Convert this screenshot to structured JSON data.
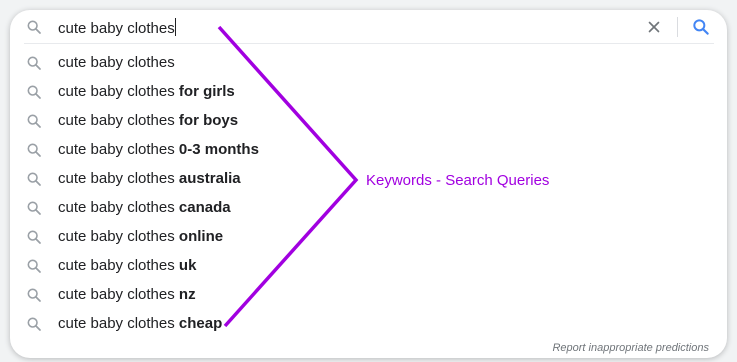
{
  "search": {
    "query": "cute baby clothes",
    "clear_icon": "close-icon",
    "submit_icon": "search-icon"
  },
  "suggestions": [
    {
      "prefix": "cute baby clothes",
      "suffix": ""
    },
    {
      "prefix": "cute baby clothes ",
      "suffix": "for girls"
    },
    {
      "prefix": "cute baby clothes ",
      "suffix": "for boys"
    },
    {
      "prefix": "cute baby clothes ",
      "suffix": "0-3 months"
    },
    {
      "prefix": "cute baby clothes ",
      "suffix": "australia"
    },
    {
      "prefix": "cute baby clothes ",
      "suffix": "canada"
    },
    {
      "prefix": "cute baby clothes ",
      "suffix": "online"
    },
    {
      "prefix": "cute baby clothes ",
      "suffix": "uk"
    },
    {
      "prefix": "cute baby clothes ",
      "suffix": "nz"
    },
    {
      "prefix": "cute baby clothes ",
      "suffix": "cheap"
    }
  ],
  "footer": {
    "report_link": "Report inappropriate predictions"
  },
  "annotation": {
    "label": "Keywords - Search Queries",
    "color": "#a100e0"
  },
  "colors": {
    "background": "#f1f3f4",
    "text": "#202124",
    "icon_gray": "#9aa0a6",
    "search_blue": "#4285f4"
  }
}
